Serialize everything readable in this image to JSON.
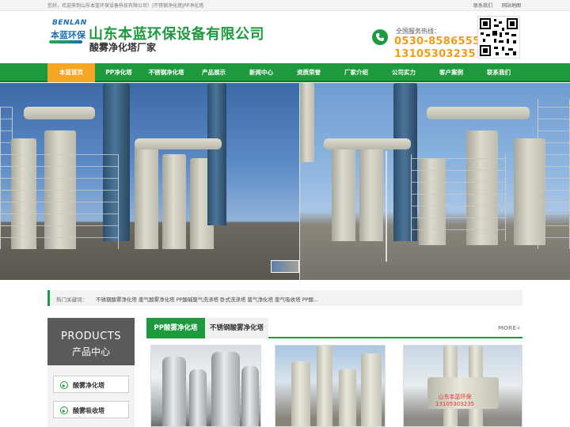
{
  "topbar": {
    "welcome": "您好，欢迎来到山东本蓝环保设备科技有限公司！|不锈钢净化塔|PP净化塔",
    "links": [
      "联系我们",
      "网站地图"
    ]
  },
  "header": {
    "logo_en": "BENLAN",
    "logo_cn": "本蓝环保",
    "company_name": "山东本蓝环保设备有限公司",
    "subtitle": "酸雾净化塔厂家",
    "hotline_label": "全国服务热线：",
    "phone1": "0530-8586555",
    "phone2": "13105303235"
  },
  "nav": {
    "items": [
      {
        "label": "本蓝首页",
        "active": true
      },
      {
        "label": "PP净化塔",
        "active": false
      },
      {
        "label": "不锈钢净化塔",
        "active": false
      },
      {
        "label": "产品展示",
        "active": false
      },
      {
        "label": "新闻中心",
        "active": false
      },
      {
        "label": "资质荣誉",
        "active": false
      },
      {
        "label": "厂家介绍",
        "active": false
      },
      {
        "label": "公司实力",
        "active": false
      },
      {
        "label": "客户案例",
        "active": false
      },
      {
        "label": "联系我们",
        "active": false
      }
    ]
  },
  "keywords": {
    "label": "热门关键词：",
    "list": "不锈钢酸雾净化塔 废气酸雾净化塔 PP酸碱废气洗涤塔 卧式洗涤塔 废气净化塔 废气吸收塔 PP酸..."
  },
  "sidebar": {
    "title_en": "PRODUCTS",
    "title_cn": "产品中心",
    "items": [
      "酸雾净化塔",
      "酸雾吸收塔"
    ]
  },
  "products": {
    "tabs": [
      "PP酸雾净化塔",
      "不锈钢酸雾净化塔"
    ],
    "more": "MORE+",
    "watermark_line1": "山东本蓝环保",
    "watermark_line2": "13105303235"
  },
  "colors": {
    "brand_green": "#1e9a3e",
    "accent_orange": "#f5a623",
    "phone_orange": "#f39c12",
    "logo_blue": "#1a6fb7"
  }
}
